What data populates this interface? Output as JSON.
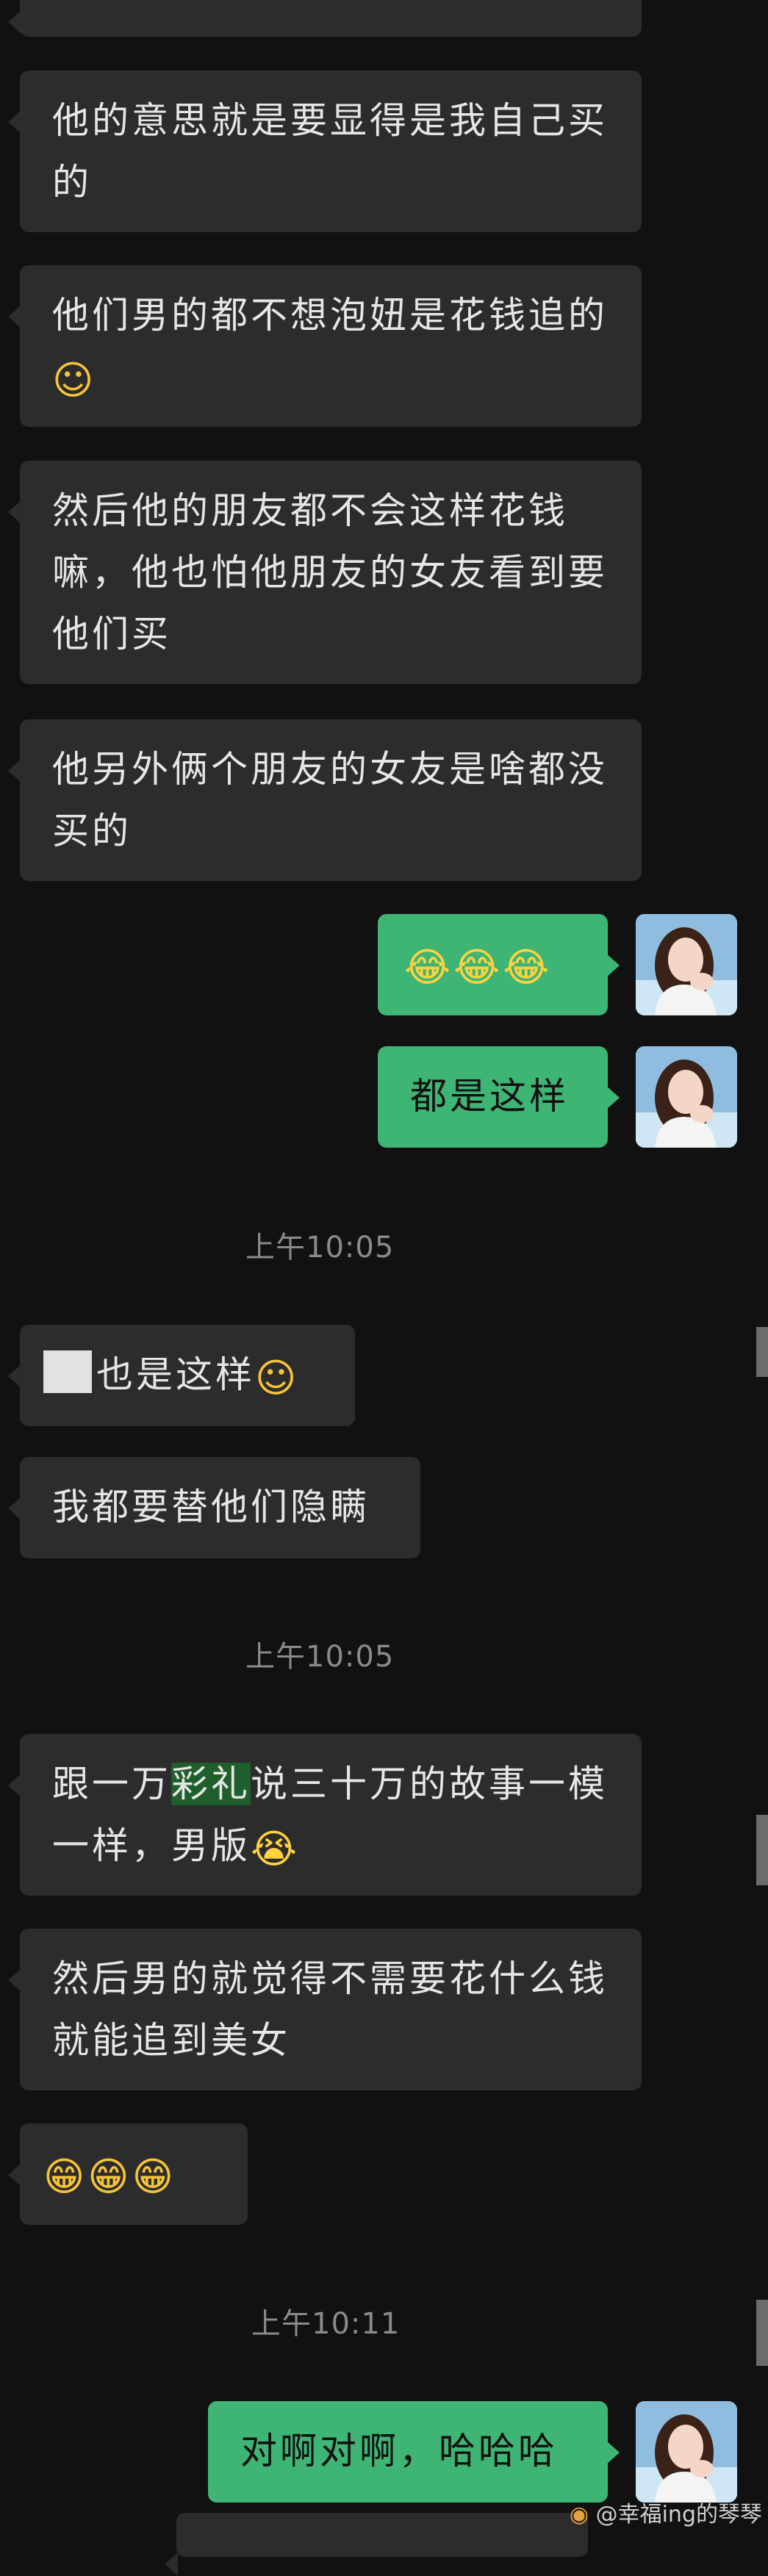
{
  "messages": [
    {
      "id": "m1",
      "side": "in",
      "text": "他的意思就是要显得是我自己买的"
    },
    {
      "id": "m2",
      "side": "in",
      "text": "他们男的都不想泡妞是花钱追的",
      "emoji": "☺"
    },
    {
      "id": "m3",
      "side": "in",
      "text": "然后他的朋友都不会这样花钱嘛，他也怕他朋友的女友看到要他们买"
    },
    {
      "id": "m4",
      "side": "in",
      "text": "他另外俩个朋友的女友是啥都没买的"
    },
    {
      "id": "m5",
      "side": "out",
      "emoji": "😂😂😂"
    },
    {
      "id": "m6",
      "side": "out",
      "text": "都是这样"
    },
    {
      "id": "m7",
      "side": "in",
      "text": "也是这样",
      "emoji": "☺"
    },
    {
      "id": "m8",
      "side": "in",
      "text": "我都要替他们隐瞒"
    },
    {
      "id": "m9",
      "side": "in",
      "text_before": "跟一万",
      "highlight": "彩礼",
      "text_after": "说三十万的故事一模一样，男版",
      "emoji": "😭"
    },
    {
      "id": "m10",
      "side": "in",
      "text": "然后男的就觉得不需要花什么钱就能追到美女"
    },
    {
      "id": "m11",
      "side": "in",
      "emoji": "😁😁😁"
    },
    {
      "id": "m12",
      "side": "out",
      "text": "对啊对啊，哈哈哈"
    }
  ],
  "timestamps": {
    "t1": "上午10:05",
    "t2": "上午10:05",
    "t3": "上午10:11"
  },
  "watermark": "@幸福ing的琴琴",
  "colors": {
    "background": "#111111",
    "incoming_bubble": "#2c2c2c",
    "outgoing_bubble": "#3eb575",
    "highlight": "#1f5f2c",
    "timestamp": "#8a8a8a"
  }
}
